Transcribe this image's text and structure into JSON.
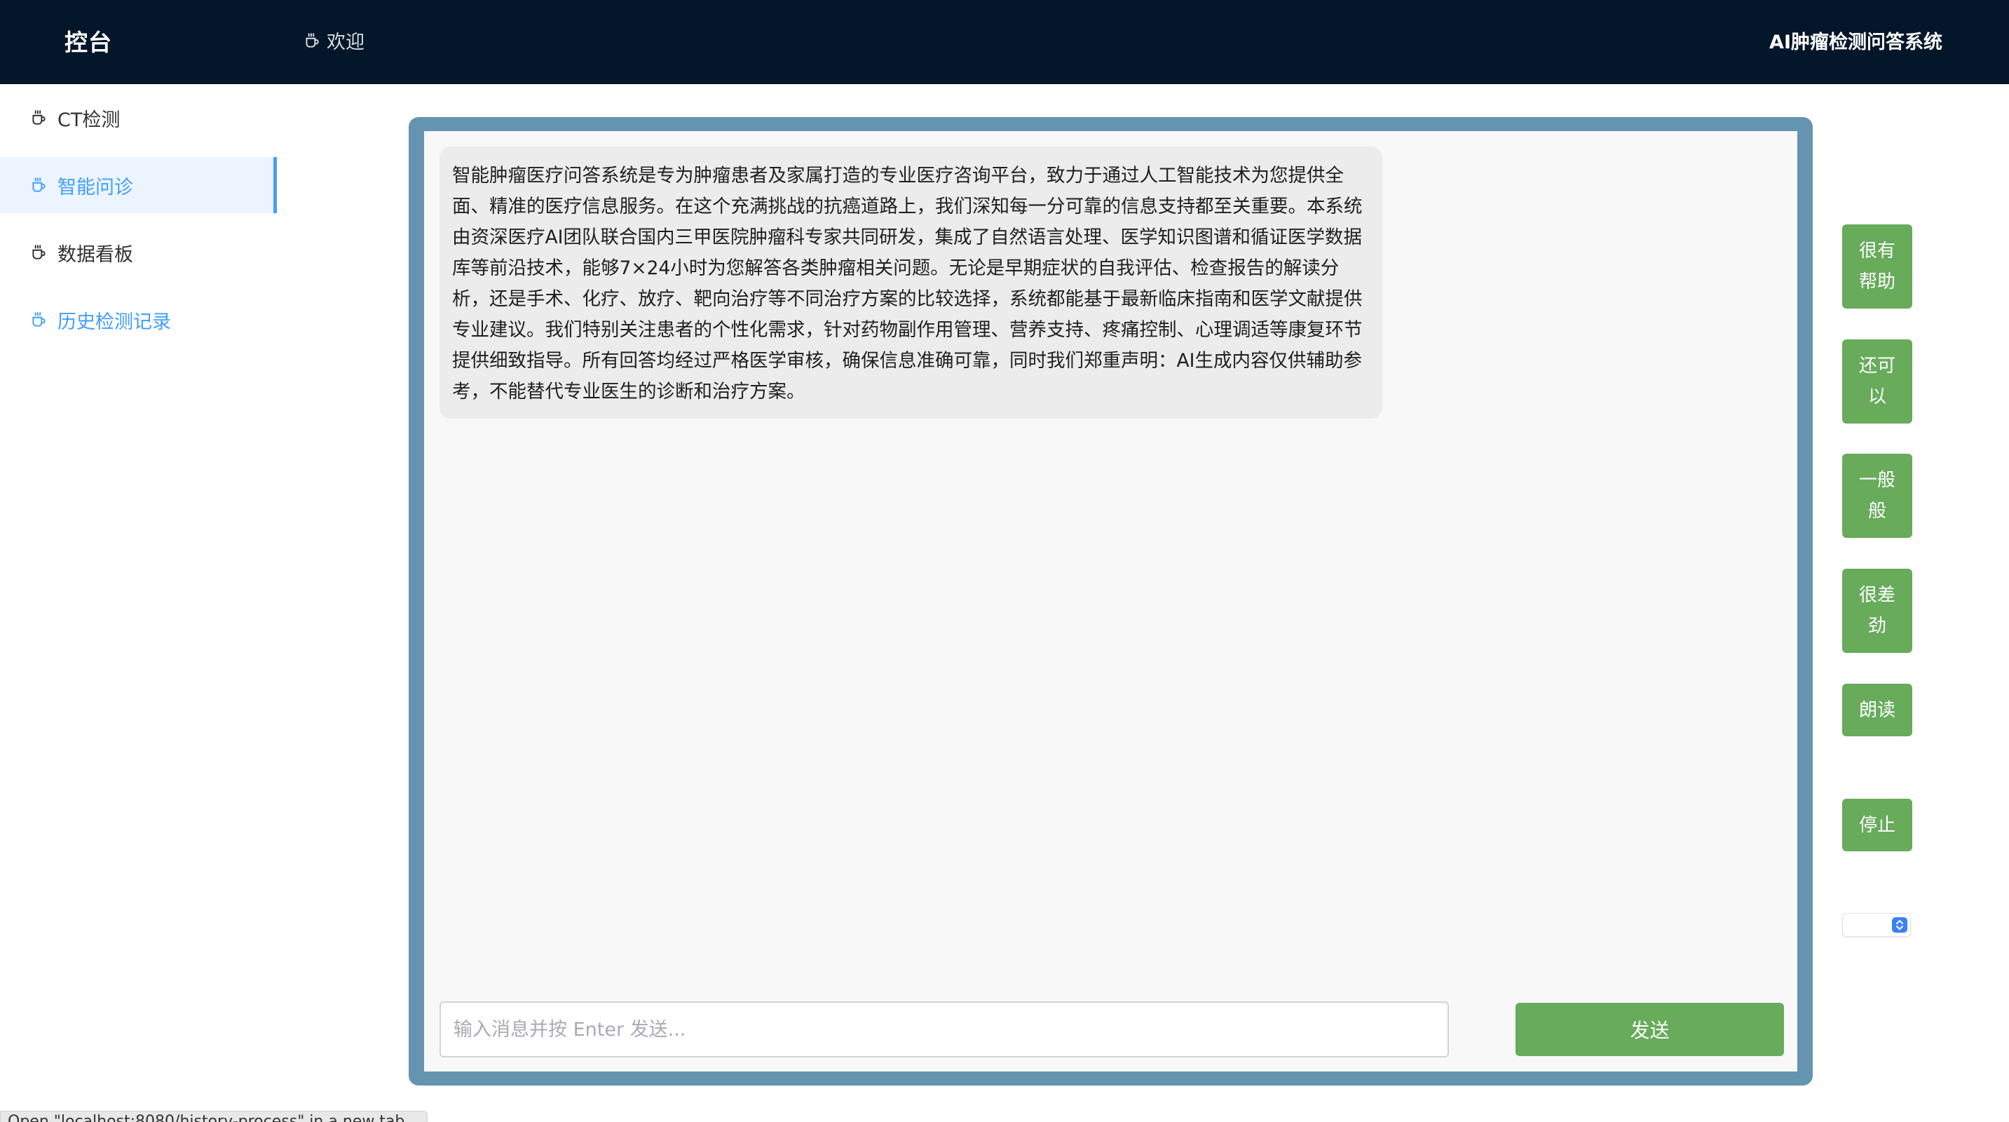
{
  "header": {
    "brand": "控台",
    "welcome_tab": "欢迎",
    "system_title": "AI肿瘤检测问答系统"
  },
  "sidebar": {
    "items": [
      {
        "label": "CT检测",
        "icon": "coffee-cup-icon"
      },
      {
        "label": "智能问诊",
        "icon": "coffee-cup-icon",
        "active": true
      },
      {
        "label": "数据看板",
        "icon": "coffee-cup-icon"
      },
      {
        "label": "历史检测记录",
        "icon": "coffee-cup-icon"
      }
    ]
  },
  "chat": {
    "messages": [
      {
        "role": "assistant",
        "text": "智能肿瘤医疗问答系统是专为肿瘤患者及家属打造的专业医疗咨询平台，致力于通过人工智能技术为您提供全面、精准的医疗信息服务。在这个充满挑战的抗癌道路上，我们深知每一分可靠的信息支持都至关重要。本系统由资深医疗AI团队联合国内三甲医院肿瘤科专家共同研发，集成了自然语言处理、医学知识图谱和循证医学数据库等前沿技术，能够7×24小时为您解答各类肿瘤相关问题。无论是早期症状的自我评估、检查报告的解读分析，还是手术、化疗、放疗、靶向治疗等不同治疗方案的比较选择，系统都能基于最新临床指南和医学文献提供专业建议。我们特别关注患者的个性化需求，针对药物副作用管理、营养支持、疼痛控制、心理调适等康复环节提供细致指导。所有回答均经过严格医学审核，确保信息准确可靠，同时我们郑重声明：AI生成内容仅供辅助参考，不能替代专业医生的诊断和治疗方案。"
      }
    ],
    "input_placeholder": "输入消息并按 Enter 发送...",
    "input_value": "",
    "send_label": "发送"
  },
  "actions": {
    "very_helpful": "很有帮助",
    "ok": "还可以",
    "average": "一般般",
    "poor": "很差劲",
    "read_aloud": "朗读",
    "stop": "停止"
  },
  "voice_select": {
    "selected": ""
  },
  "status_bar": {
    "text": "Open \"localhost:8080/history-process\" in a new tab"
  },
  "colors": {
    "header_bg": "#041629",
    "accent": "#409eff",
    "button_green": "#67ab5b",
    "chat_frame": "#6494af"
  }
}
